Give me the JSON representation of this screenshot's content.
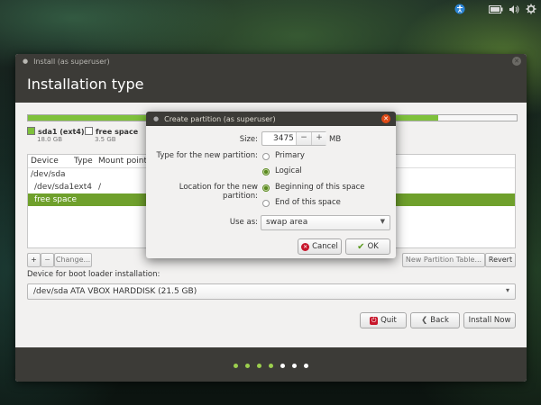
{
  "tray": {
    "icons": [
      "accessibility-icon",
      "battery-icon",
      "volume-icon",
      "settings-icon"
    ]
  },
  "window": {
    "title": "Install (as superuser)",
    "heading": "Installation type"
  },
  "partition_bar": {
    "used_fraction": 0.84,
    "colors": {
      "used": "#7ec13b",
      "free": "#f8f8f8"
    },
    "legend": [
      {
        "name": "sda1 (ext4)",
        "size": "18.0 GB",
        "color": "#7ec13b"
      },
      {
        "name": "free space",
        "size": "3.5 GB",
        "color": "#ffffff"
      }
    ]
  },
  "table": {
    "columns": [
      "Device",
      "Type",
      "Mount point"
    ],
    "rows": [
      {
        "device": "/dev/sda",
        "type": "",
        "mount": "",
        "selected": false
      },
      {
        "device": "/dev/sda1",
        "type": "ext4",
        "mount": "/",
        "selected": false
      },
      {
        "device": "free space",
        "type": "",
        "mount": "",
        "selected": true
      }
    ]
  },
  "table_buttons": {
    "add": "+",
    "remove": "−",
    "change": "Change...",
    "new_table": "New Partition Table...",
    "revert": "Revert"
  },
  "boot_loader": {
    "label": "Device for boot loader installation:",
    "device": "/dev/sda",
    "description": "ATA VBOX HARDDISK (21.5 GB)"
  },
  "bottom_buttons": {
    "quit": "Quit",
    "back": "Back",
    "install": "Install Now"
  },
  "progress_dots": {
    "total": 7,
    "active": 4
  },
  "dialog": {
    "title": "Create partition (as superuser)",
    "size_label": "Size:",
    "size_value": "3475",
    "size_unit": "MB",
    "minus": "−",
    "plus": "+",
    "type_label": "Type for the new partition:",
    "type_options": [
      "Primary",
      "Logical"
    ],
    "type_selected": "Logical",
    "location_label": "Location for the new partition:",
    "location_options": [
      "Beginning of this space",
      "End of this space"
    ],
    "location_selected": "Beginning of this space",
    "use_as_label": "Use as:",
    "use_as_value": "swap area",
    "cancel": "Cancel",
    "ok": "OK"
  }
}
